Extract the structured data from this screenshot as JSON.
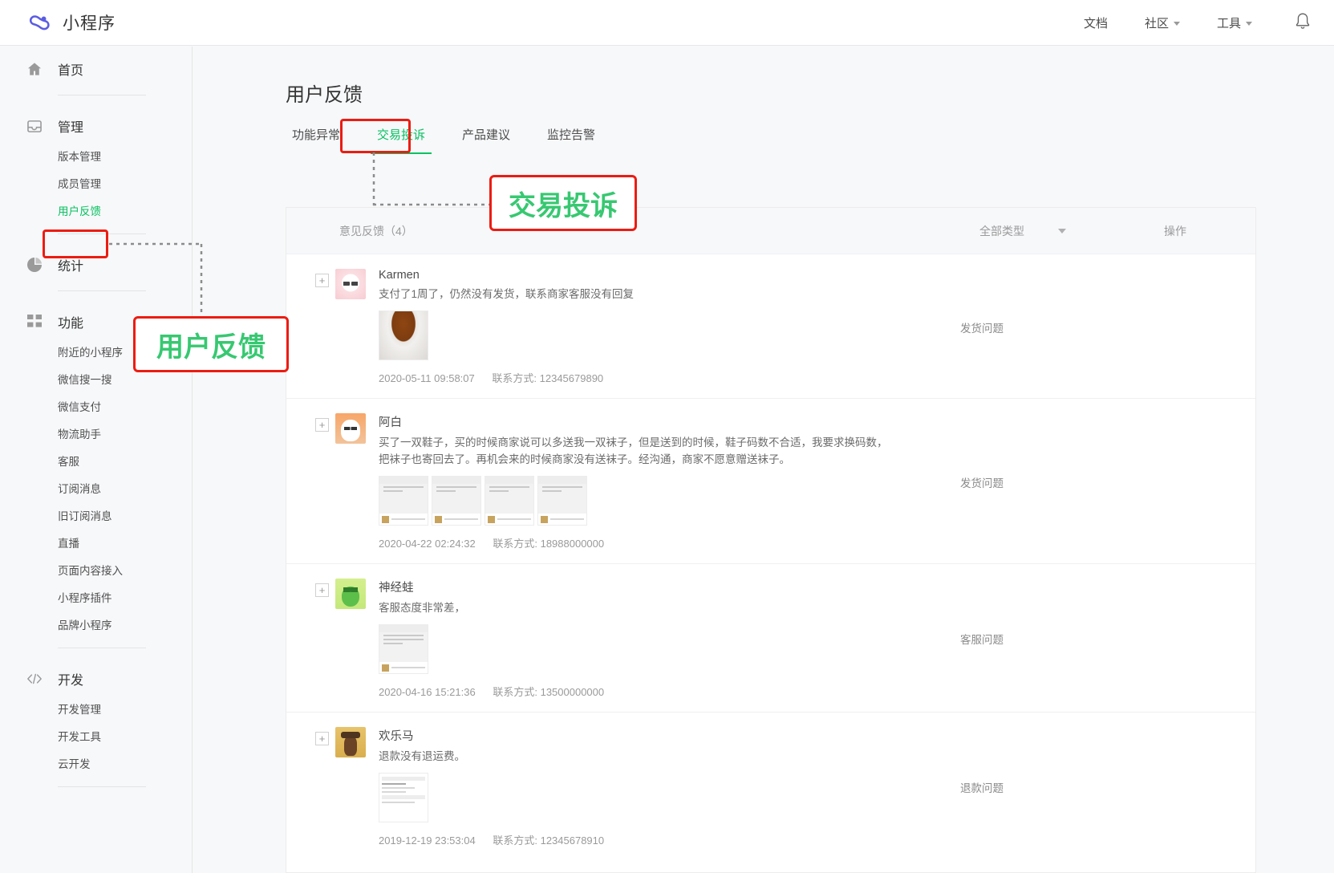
{
  "topbar": {
    "brand": "小程序",
    "nav": [
      {
        "label": "文档",
        "has_caret": false
      },
      {
        "label": "社区",
        "has_caret": true
      },
      {
        "label": "工具",
        "has_caret": true
      }
    ],
    "bell_icon": "bell-icon"
  },
  "sidebar": {
    "groups": [
      {
        "icon": "home-icon",
        "label": "首页",
        "items": []
      },
      {
        "icon": "inbox-icon",
        "label": "管理",
        "items": [
          {
            "label": "版本管理",
            "active": false
          },
          {
            "label": "成员管理",
            "active": false
          },
          {
            "label": "用户反馈",
            "active": true
          }
        ]
      },
      {
        "icon": "pie-chart-icon",
        "label": "统计",
        "items": []
      },
      {
        "icon": "grid-icon",
        "label": "功能",
        "items": [
          {
            "label": "附近的小程序",
            "active": false
          },
          {
            "label": "微信搜一搜",
            "active": false
          },
          {
            "label": "微信支付",
            "active": false
          },
          {
            "label": "物流助手",
            "active": false
          },
          {
            "label": "客服",
            "active": false
          },
          {
            "label": "订阅消息",
            "active": false
          },
          {
            "label": "旧订阅消息",
            "active": false
          },
          {
            "label": "直播",
            "active": false
          },
          {
            "label": "页面内容接入",
            "active": false
          },
          {
            "label": "小程序插件",
            "active": false
          },
          {
            "label": "品牌小程序",
            "active": false
          }
        ]
      },
      {
        "icon": "code-icon",
        "label": "开发",
        "items": [
          {
            "label": "开发管理",
            "active": false
          },
          {
            "label": "开发工具",
            "active": false
          },
          {
            "label": "云开发",
            "active": false
          }
        ]
      }
    ]
  },
  "main": {
    "page_title": "用户反馈",
    "tabs": [
      {
        "label": "功能异常",
        "active": false
      },
      {
        "label": "交易投诉",
        "active": true
      },
      {
        "label": "产品建议",
        "active": false
      },
      {
        "label": "监控告警",
        "active": false
      }
    ],
    "table": {
      "header": {
        "feedback_col": "意见反馈（4）",
        "type_filter": "全部类型",
        "type_filter_icon": "chevron-down-icon",
        "action_col": "操作"
      },
      "rows": [
        {
          "expand_icon": "+",
          "avatar": "avatar-karmen",
          "username": "Karmen",
          "content": "支付了1周了，仍然没有发货，联系商家客服没有回复",
          "thumbs": [
            "coffee-cup-photo"
          ],
          "date": "2020-05-11 09:58:07",
          "contact_label": "联系方式:",
          "contact_value": "12345679890",
          "type": "发货问题"
        },
        {
          "expand_icon": "+",
          "avatar": "avatar-abai",
          "username": "阿白",
          "content": "买了一双鞋子，买的时候商家说可以多送我一双袜子，但是送到的时候，鞋子码数不合适，我要求换码数，把袜子也寄回去了。再机会来的时候商家没有送袜子。经沟通，商家不愿意赠送袜子。",
          "thumbs": [
            "chat-screenshot",
            "chat-screenshot",
            "chat-screenshot",
            "chat-screenshot"
          ],
          "date": "2020-04-22 02:24:32",
          "contact_label": "联系方式:",
          "contact_value": "18988000000",
          "type": "发货问题"
        },
        {
          "expand_icon": "+",
          "avatar": "avatar-frog",
          "username": "神经蛙",
          "content": "客服态度非常差，",
          "thumbs": [
            "chat-screenshot-tall"
          ],
          "date": "2020-04-16 15:21:36",
          "contact_label": "联系方式:",
          "contact_value": "13500000000",
          "type": "客服问题"
        },
        {
          "expand_icon": "+",
          "avatar": "avatar-horse",
          "username": "欢乐马",
          "content": "退款没有退运费。",
          "thumbs": [
            "order-screenshot"
          ],
          "date": "2019-12-19 23:53:04",
          "contact_label": "联系方式:",
          "contact_value": "12345678910",
          "type": "退款问题"
        }
      ]
    }
  },
  "annotations": {
    "sidebar_callout": "用户反馈",
    "tab_callout": "交易投诉",
    "box_color": "#ec1c12",
    "text_color": "#37c871"
  }
}
